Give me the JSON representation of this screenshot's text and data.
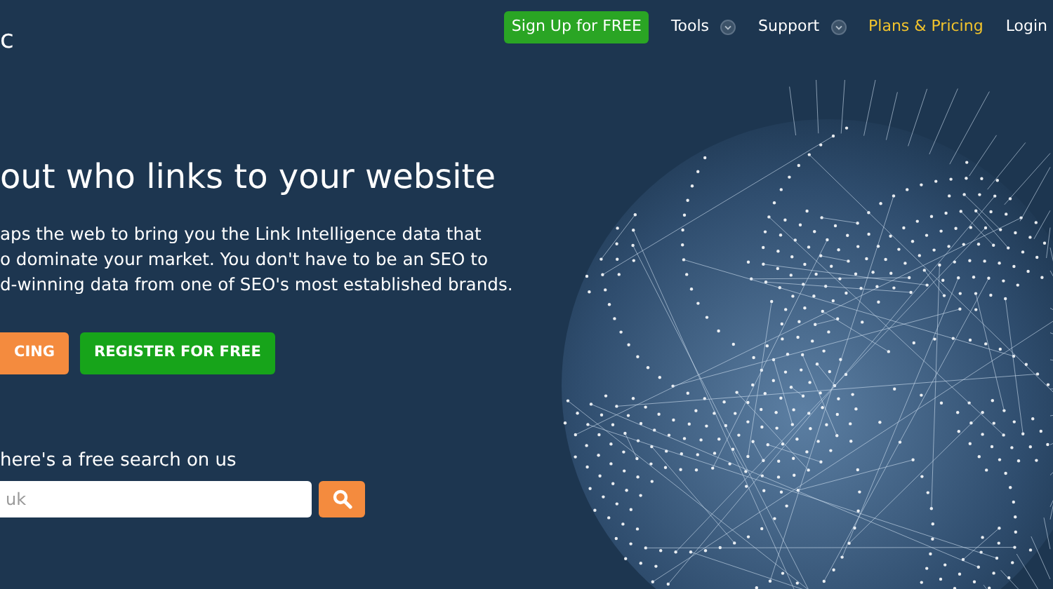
{
  "logo": "c",
  "nav": [
    {
      "kind": "button",
      "label": "Sign Up for FREE"
    },
    {
      "kind": "dropdown",
      "label": "Tools"
    },
    {
      "kind": "dropdown",
      "label": "Support"
    },
    {
      "kind": "highlight",
      "label": "Plans & Pricing"
    },
    {
      "kind": "link",
      "label": "Login"
    }
  ],
  "hero": {
    "heading": "out who links to your website",
    "lines": [
      "aps the web to bring you the Link Intelligence data that",
      "o dominate your market. You don't have to be an SEO to",
      "d-winning data from one of SEO's most established brands."
    ],
    "buttons": [
      {
        "kind": "orange",
        "label": "CING"
      },
      {
        "kind": "green",
        "label": "REGISTER FOR FREE"
      }
    ]
  },
  "search": {
    "label": "here's a free search on us",
    "placeholder": "uk"
  }
}
